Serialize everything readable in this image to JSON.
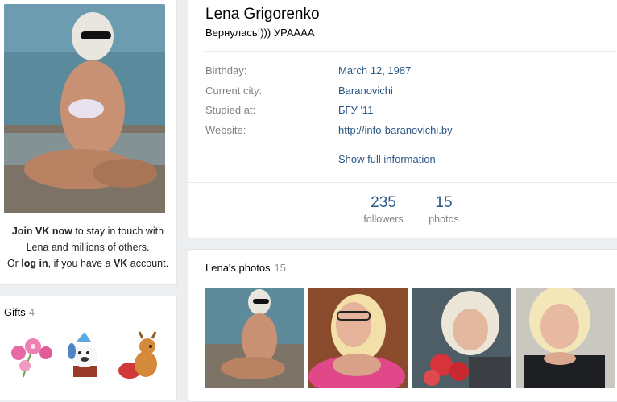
{
  "profile": {
    "name": "Lena Grigorenko",
    "status": "Вернулась!))) УРАААА"
  },
  "info": [
    {
      "label": "Birthday:",
      "value": "March 12, 1987"
    },
    {
      "label": "Current city:",
      "value": "Baranovichi"
    },
    {
      "label": "Studied at:",
      "value": "БГУ '11"
    },
    {
      "label": "Website:",
      "value": "http://info-baranovichi.by"
    }
  ],
  "show_full": "Show full information",
  "counters": [
    {
      "num": "235",
      "label": "followers"
    },
    {
      "num": "15",
      "label": "photos"
    }
  ],
  "join": {
    "strong1": "Join VK now",
    "text1": " to stay in touch with",
    "text2": "Lena and millions of others.",
    "text3": "Or ",
    "login": "log in",
    "text4": ", if you have a ",
    "vk": "VK",
    "text5": " account."
  },
  "gifts": {
    "title": "Gifts",
    "count": "4"
  },
  "photos": {
    "title": "Lena's photos",
    "count": "15"
  },
  "colors": {
    "link": "#2a5885",
    "muted": "#828282",
    "bg": "#edeef0"
  }
}
